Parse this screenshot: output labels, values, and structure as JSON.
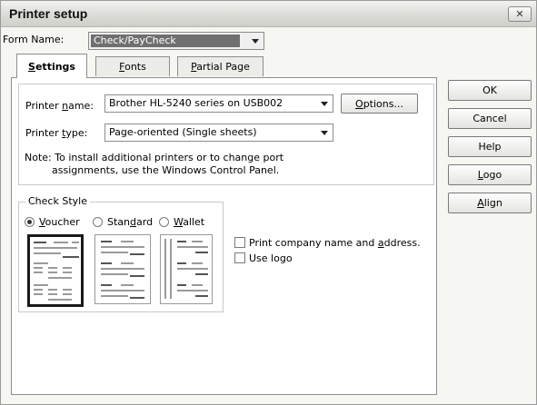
{
  "window": {
    "title": "Printer setup",
    "close_glyph": "✕"
  },
  "form": {
    "label": "Form Name:",
    "value": "Check/PayCheck"
  },
  "tabs": [
    {
      "label": "Settings",
      "key": "S",
      "rest": "ettings",
      "active": true
    },
    {
      "label": "Fonts",
      "key": "F",
      "rest": "onts",
      "active": false
    },
    {
      "label": "Partial Page",
      "key": "P",
      "rest": "artial Page",
      "active": false
    }
  ],
  "printer_name": {
    "pre": "Printer ",
    "key": "n",
    "post": "ame:",
    "value": "Brother HL-5240 series on USB002"
  },
  "printer_type": {
    "pre": "Printer ",
    "key": "t",
    "post": "ype:",
    "value": "Page-oriented (Single sheets)"
  },
  "options_button": {
    "key": "O",
    "rest": "ptions..."
  },
  "note": {
    "line1": "Note: To install additional printers or to change port",
    "line2": "assignments, use the Windows Control Panel."
  },
  "check_style": {
    "label": "Check Style",
    "options": [
      {
        "label": "Voucher",
        "pre": "",
        "key": "V",
        "post": "oucher",
        "selected": true
      },
      {
        "label": "Standard",
        "pre": "Stan",
        "key": "d",
        "post": "ard",
        "selected": false
      },
      {
        "label": "Wallet",
        "pre": "",
        "key": "W",
        "post": "allet",
        "selected": false
      }
    ]
  },
  "print_company": {
    "pre": "Print company name and ",
    "key": "a",
    "post": "ddress.",
    "checked": false
  },
  "use_logo": {
    "label": "Use logo",
    "checked": false
  },
  "buttons": {
    "ok": "OK",
    "cancel": "Cancel",
    "help": "Help",
    "logo": {
      "key": "L",
      "rest": "ogo"
    },
    "align": {
      "key": "A",
      "rest": "lign"
    }
  }
}
